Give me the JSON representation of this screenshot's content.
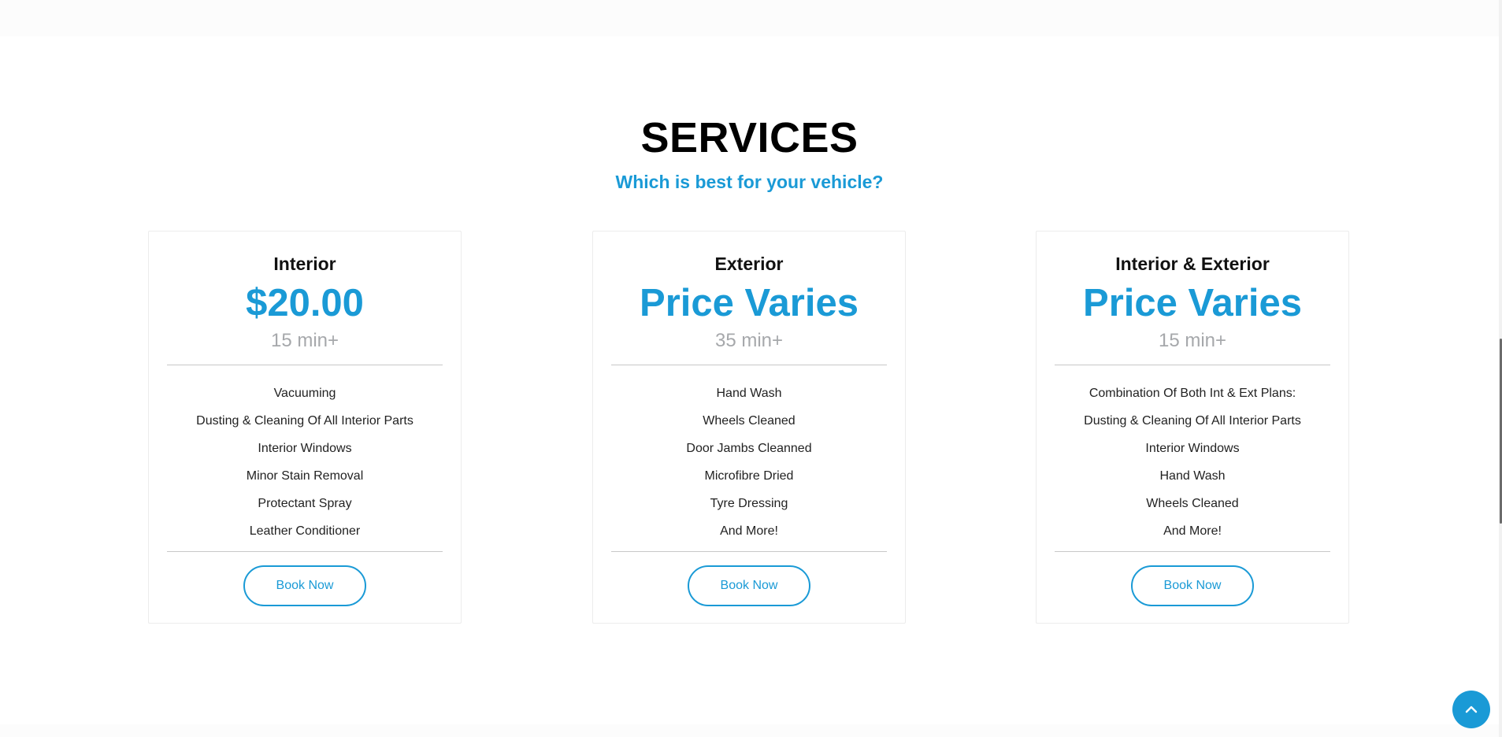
{
  "section": {
    "title": "SERVICES",
    "subtitle": "Which is best for your vehicle?"
  },
  "colors": {
    "accent": "#1a9ad6",
    "muted": "#a6a8ab",
    "text": "#222222"
  },
  "cards": [
    {
      "title": "Interior",
      "price": "$20.00",
      "duration": "15 min+",
      "features": [
        "Vacuuming",
        "Dusting & Cleaning Of All Interior Parts",
        "Interior Windows",
        "Minor Stain Removal",
        "Protectant Spray",
        "Leather Conditioner"
      ],
      "button_label": "Book Now"
    },
    {
      "title": "Exterior",
      "price": "Price Varies",
      "duration": "35 min+",
      "features": [
        "Hand Wash",
        "Wheels Cleaned",
        "Door Jambs Cleanned",
        "Microfibre Dried",
        "Tyre Dressing",
        "And More!"
      ],
      "button_label": "Book Now"
    },
    {
      "title": "Interior & Exterior",
      "price": "Price Varies",
      "duration": "15 min+",
      "features": [
        "Combination Of Both Int & Ext Plans:",
        "Dusting & Cleaning Of All Interior Parts",
        "Interior Windows",
        "Hand Wash",
        "Wheels Cleaned",
        "And More!"
      ],
      "button_label": "Book Now"
    }
  ],
  "scroll_top": {
    "icon": "chevron-up-icon"
  }
}
